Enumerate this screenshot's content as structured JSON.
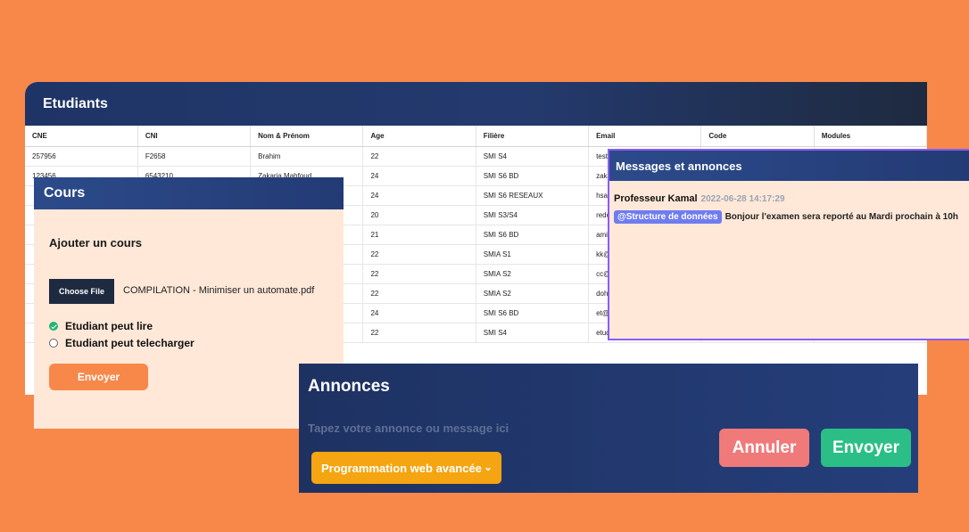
{
  "etudiants": {
    "title": "Etudiants",
    "columns": [
      "CNE",
      "CNI",
      "Nom & Prénom",
      "Age",
      "Filière",
      "Email",
      "Code",
      "Modules"
    ],
    "rows": [
      [
        "257956",
        "F2658",
        "Brahim",
        "22",
        "SMI S4",
        "testi",
        "",
        ""
      ],
      [
        "123456",
        "6543210",
        "Zakaria Mahfoud",
        "24",
        "SMI S6 BD",
        "zaka",
        "",
        ""
      ],
      [
        "",
        "",
        "",
        "24",
        "SMI S6 RESEAUX",
        "hsaa",
        "",
        ""
      ],
      [
        "",
        "",
        "",
        "20",
        "SMI S3/S4",
        "redo",
        "",
        ""
      ],
      [
        "",
        "",
        "",
        "21",
        "SMI S6 BD",
        "amir",
        "",
        ""
      ],
      [
        "",
        "",
        "",
        "22",
        "SMIA S1",
        "kk@",
        "",
        ""
      ],
      [
        "",
        "",
        "",
        "22",
        "SMIA S2",
        "cc@",
        "",
        ""
      ],
      [
        "",
        "",
        "",
        "22",
        "SMIA S2",
        "doh",
        "",
        ""
      ],
      [
        "",
        "",
        "",
        "24",
        "SMI S6 BD",
        "et@",
        "",
        ""
      ],
      [
        "",
        "",
        "",
        "22",
        "SMI S4",
        "etud",
        "",
        ""
      ]
    ]
  },
  "cours": {
    "title": "Cours",
    "subtitle": "Ajouter un cours",
    "choose_file_label": "Choose File",
    "file_name": "COMPILATION - Minimiser un automate.pdf",
    "options": [
      {
        "label": "Etudiant peut lire",
        "checked": true
      },
      {
        "label": "Etudiant peut telecharger",
        "checked": false
      }
    ],
    "submit_label": "Envoyer"
  },
  "messages": {
    "title": "Messages et annonces",
    "items": [
      {
        "author": "Professeur Kamal",
        "date": "2022-06-28 14:17:29",
        "tag": "@Structure de données",
        "text": "Bonjour l'examen sera reporté au Mardi prochain à 10h"
      }
    ]
  },
  "annonces": {
    "title": "Annonces",
    "input_placeholder": "Tapez votre annonce ou message ici",
    "input_value": "",
    "selected_module": "Programmation web avancée",
    "cancel_label": "Annuler",
    "send_label": "Envoyer"
  },
  "colors": {
    "background": "#f7884a",
    "header_navy": "#233b75",
    "panel_cream": "#ffe8d8",
    "select_orange": "#f5a511",
    "cancel_red": "#f07a7a",
    "send_green": "#2bbf87",
    "tag_purple": "#6f7cf0"
  }
}
